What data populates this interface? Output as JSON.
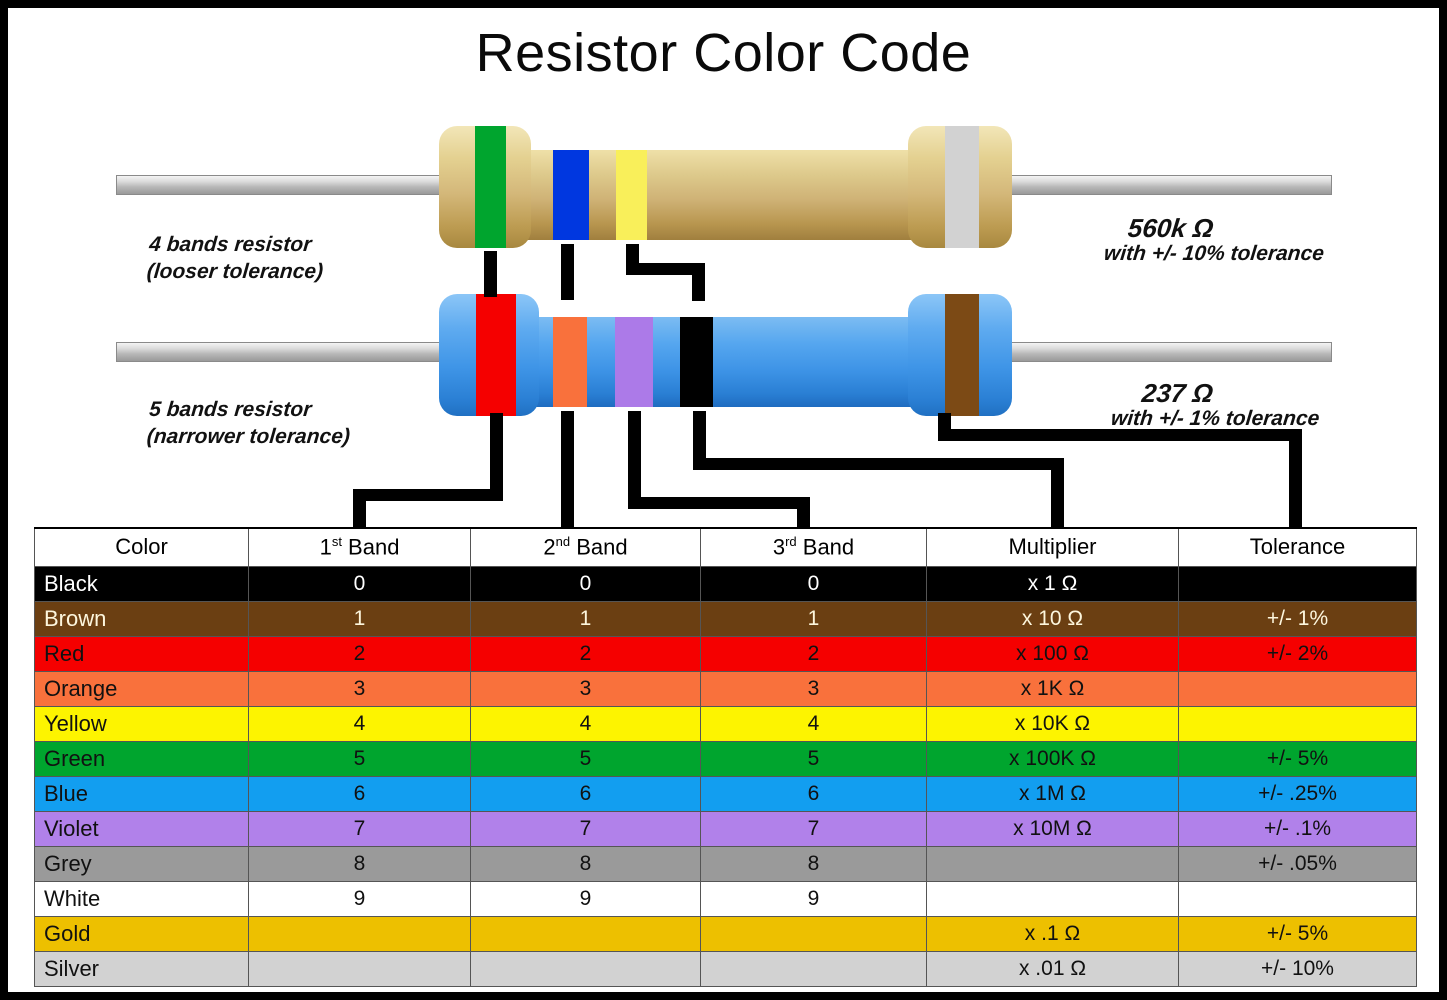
{
  "title": "Resistor Color Code",
  "resistors": [
    {
      "id": "four-band",
      "label_line1": "4 bands resistor",
      "label_line2": "(looser tolerance)",
      "value": "560k Ω",
      "tolerance_text": "with +/- 10% tolerance",
      "body_color": "#cfb276",
      "bands": [
        "#00a52e",
        "#0037e0",
        "#f9ef5a",
        "#d0d0d0"
      ],
      "band_names": [
        "green",
        "blue",
        "yellow",
        "silver"
      ]
    },
    {
      "id": "five-band",
      "label_line1": "5 bands resistor",
      "label_line2": "(narrower tolerance)",
      "value": "237 Ω",
      "tolerance_text": "with +/- 1% tolerance",
      "body_color": "#3d93e6",
      "bands": [
        "#f50000",
        "#f97534",
        "#ac7ae8",
        "#000000",
        "#7c4a15"
      ],
      "band_names": [
        "red",
        "orange",
        "violet",
        "black",
        "brown"
      ]
    }
  ],
  "table": {
    "headers": [
      {
        "text": "Color",
        "sup": ""
      },
      {
        "text": "1",
        "sup": "st",
        "suffix": " Band"
      },
      {
        "text": "2",
        "sup": "nd",
        "suffix": " Band"
      },
      {
        "text": "3",
        "sup": "rd",
        "suffix": " Band"
      },
      {
        "text": "Multiplier",
        "sup": ""
      },
      {
        "text": "Tolerance",
        "sup": ""
      }
    ],
    "rows": [
      {
        "color": "Black",
        "bg": "#000000",
        "fg": "#ffffff",
        "b1": "0",
        "b2": "0",
        "b3": "0",
        "mult": "x 1 Ω",
        "tol": ""
      },
      {
        "color": "Brown",
        "bg": "#6b3f12",
        "fg": "#fdf6dd",
        "b1": "1",
        "b2": "1",
        "b3": "1",
        "mult": "x 10 Ω",
        "tol": "+/-  1%"
      },
      {
        "color": "Red",
        "bg": "#f50000",
        "fg": "#111111",
        "b1": "2",
        "b2": "2",
        "b3": "2",
        "mult": "x 100 Ω",
        "tol": "+/-  2%"
      },
      {
        "color": "Orange",
        "bg": "#f9713c",
        "fg": "#111111",
        "b1": "3",
        "b2": "3",
        "b3": "3",
        "mult": "x 1K Ω",
        "tol": ""
      },
      {
        "color": "Yellow",
        "bg": "#fdf400",
        "fg": "#111111",
        "b1": "4",
        "b2": "4",
        "b3": "4",
        "mult": "x 10K Ω",
        "tol": ""
      },
      {
        "color": "Green",
        "bg": "#00a52e",
        "fg": "#111111",
        "b1": "5",
        "b2": "5",
        "b3": "5",
        "mult": "x 100K Ω",
        "tol": "+/-  5%"
      },
      {
        "color": "Blue",
        "bg": "#129ef0",
        "fg": "#111111",
        "b1": "6",
        "b2": "6",
        "b3": "6",
        "mult": "x 1M Ω",
        "tol": "+/-  .25%"
      },
      {
        "color": "Violet",
        "bg": "#b181ea",
        "fg": "#111111",
        "b1": "7",
        "b2": "7",
        "b3": "7",
        "mult": "x 10M Ω",
        "tol": "+/-  .1%"
      },
      {
        "color": "Grey",
        "bg": "#9a9a9a",
        "fg": "#111111",
        "b1": "8",
        "b2": "8",
        "b3": "8",
        "mult": "",
        "tol": "+/-  .05%"
      },
      {
        "color": "White",
        "bg": "#ffffff",
        "fg": "#111111",
        "b1": "9",
        "b2": "9",
        "b3": "9",
        "mult": "",
        "tol": ""
      },
      {
        "color": "Gold",
        "bg": "#edc000",
        "fg": "#111111",
        "b1": "",
        "b2": "",
        "b3": "",
        "mult": "x .1 Ω",
        "tol": "+/-  5%"
      },
      {
        "color": "Silver",
        "bg": "#d2d2d2",
        "fg": "#111111",
        "b1": "",
        "b2": "",
        "b3": "",
        "mult": "x .01 Ω",
        "tol": "+/-  10%"
      }
    ]
  },
  "chart_data": {
    "type": "table",
    "title": "Resistor Color Code",
    "columns": [
      "Color",
      "1st Band",
      "2nd Band",
      "3rd Band",
      "Multiplier",
      "Tolerance"
    ],
    "rows": [
      [
        "Black",
        "0",
        "0",
        "0",
        "x 1 Ω",
        ""
      ],
      [
        "Brown",
        "1",
        "1",
        "1",
        "x 10 Ω",
        "+/- 1%"
      ],
      [
        "Red",
        "2",
        "2",
        "2",
        "x 100 Ω",
        "+/- 2%"
      ],
      [
        "Orange",
        "3",
        "3",
        "3",
        "x 1K Ω",
        ""
      ],
      [
        "Yellow",
        "4",
        "4",
        "4",
        "x 10K Ω",
        ""
      ],
      [
        "Green",
        "5",
        "5",
        "5",
        "x 100K Ω",
        "+/- 5%"
      ],
      [
        "Blue",
        "6",
        "6",
        "6",
        "x 1M Ω",
        "+/- .25%"
      ],
      [
        "Violet",
        "7",
        "7",
        "7",
        "x 10M Ω",
        "+/- .1%"
      ],
      [
        "Grey",
        "8",
        "8",
        "8",
        "",
        "+/- .05%"
      ],
      [
        "White",
        "9",
        "9",
        "9",
        "",
        ""
      ],
      [
        "Gold",
        "",
        "",
        "",
        "x .1 Ω",
        "+/- 5%"
      ],
      [
        "Silver",
        "",
        "",
        "",
        "x .01 Ω",
        "+/- 10%"
      ]
    ],
    "examples": [
      {
        "bands": [
          "green",
          "blue",
          "yellow",
          "silver"
        ],
        "value": "560k Ω",
        "tolerance": "+/- 10%"
      },
      {
        "bands": [
          "red",
          "orange",
          "violet",
          "black",
          "brown"
        ],
        "value": "237 Ω",
        "tolerance": "+/- 1%"
      }
    ]
  }
}
